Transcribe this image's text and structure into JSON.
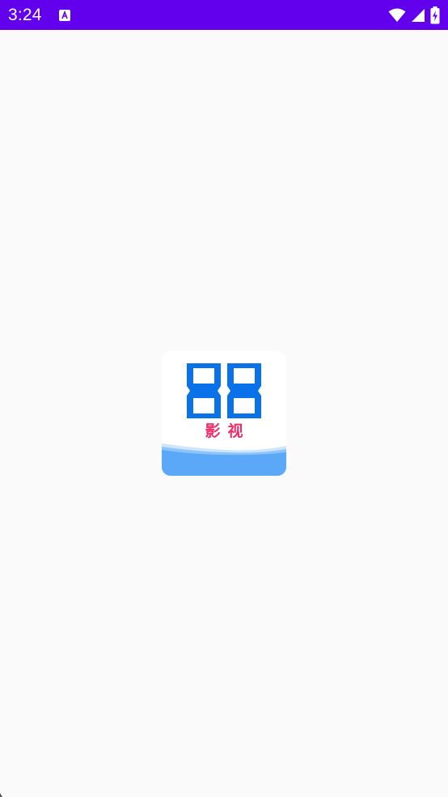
{
  "status_bar": {
    "time": "3:24",
    "background": "#6200ee",
    "icons": [
      "notification-a-icon",
      "wifi-icon",
      "cell-signal-icon",
      "battery-charging-icon"
    ]
  },
  "splash": {
    "logo_numeral": "88",
    "logo_text": "影视",
    "colors": {
      "numeral": "#0a72e8",
      "text": "#ee2c6a",
      "wave": "#5aa8f7",
      "page_background": "#fafafa"
    }
  }
}
